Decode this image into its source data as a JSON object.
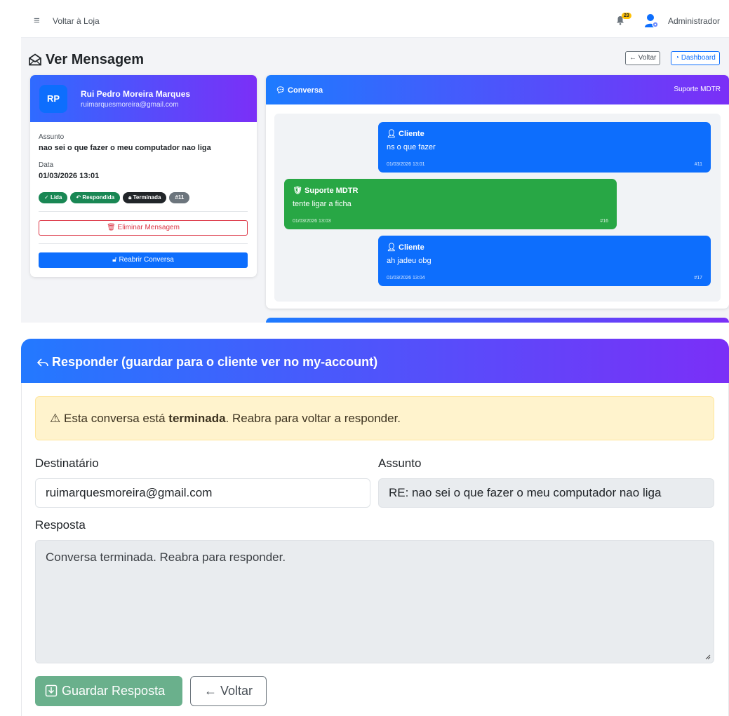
{
  "navbar": {
    "menu_icon": "hamburger-icon",
    "back_to_store": "Voltar à Loja",
    "notification_count": "23",
    "user_label": "Administrador"
  },
  "page": {
    "title": "Ver Mensagem",
    "back_button": "← Voltar",
    "dashboard_button": "Dashboard"
  },
  "sender": {
    "initials": "RP",
    "name": "Rui Pedro Moreira Marques",
    "email": "ruimarquesmoreira@gmail.com",
    "subject_label": "Assunto",
    "subject": "nao sei o que fazer o meu computador nao liga",
    "date_label": "Data",
    "date": "01/03/2026 13:01",
    "badges": [
      "Lida",
      "Respondida",
      "Terminada",
      "#11"
    ],
    "delete_button": "Eliminar Mensagem",
    "reopen_button": "Reabrir Conversa"
  },
  "conversation": {
    "title": "Conversa",
    "right_label": "Suporte MDTR",
    "messages": [
      {
        "who": "Cliente",
        "text": "ns o que fazer",
        "time": "01/03/2026 13:01",
        "num": "#11"
      },
      {
        "who": "Suporte MDTR",
        "text": "tente ligar a ficha",
        "time": "01/03/2026 13:03",
        "num": "#16"
      },
      {
        "who": "Cliente",
        "text": "ah jadeu obg",
        "time": "01/03/2026 13:04",
        "num": "#17"
      }
    ]
  },
  "reply": {
    "title": "Responder (guardar para o cliente ver no my-account)",
    "alert_before": "Esta conversa está ",
    "alert_bold": "terminada",
    "alert_after": ". Reabra para voltar a responder.",
    "to_label": "Destinatário",
    "to_value": "ruimarquesmoreira@gmail.com",
    "subject_label": "Assunto",
    "subject_value": "RE: nao sei o que fazer o meu computador nao liga",
    "body_label": "Resposta",
    "body_value": "Conversa terminada. Reabra para responder.",
    "save_button": "Guardar Resposta",
    "back_button": "← Voltar"
  },
  "colors": {
    "primary": "#0d6efd",
    "success": "#198754",
    "support_bubble": "#28a745",
    "danger": "#dc3545",
    "gradient_start": "#2379ff",
    "gradient_end": "#7b2ff7",
    "warning_bg": "#fff3cd"
  }
}
